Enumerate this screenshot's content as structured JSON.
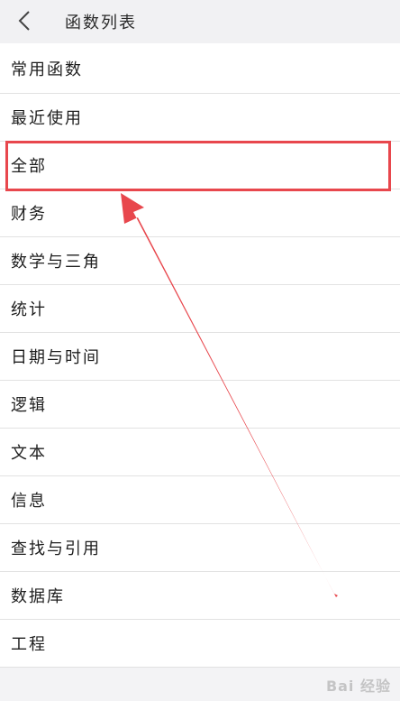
{
  "header": {
    "back_icon": "chevron-left-icon",
    "title": "函数列表"
  },
  "list": {
    "items": [
      {
        "label": "常用函数"
      },
      {
        "label": "最近使用"
      },
      {
        "label": "全部"
      },
      {
        "label": "财务"
      },
      {
        "label": "数学与三角"
      },
      {
        "label": "统计"
      },
      {
        "label": "日期与时间"
      },
      {
        "label": "逻辑"
      },
      {
        "label": "文本"
      },
      {
        "label": "信息"
      },
      {
        "label": "查找与引用"
      },
      {
        "label": "数据库"
      },
      {
        "label": "工程"
      }
    ]
  },
  "annotation": {
    "highlight_color": "#e8474d",
    "highlighted_item": "全部"
  },
  "watermark": {
    "text": "Bai 经验"
  }
}
